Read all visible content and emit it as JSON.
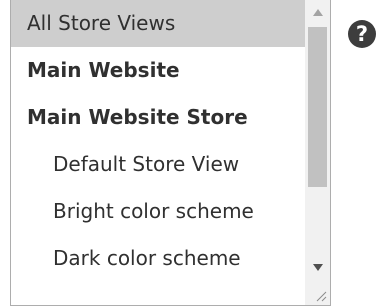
{
  "store_selector": {
    "options": [
      {
        "label": "All Store Views",
        "selected": true
      },
      {
        "label": "Main Website"
      },
      {
        "label": "Main Website Store"
      },
      {
        "label": "Default Store View"
      },
      {
        "label": "Bright color scheme"
      },
      {
        "label": "Dark color scheme"
      }
    ]
  },
  "help": {
    "glyph": "?"
  },
  "icons": {
    "scroll_up": "scroll-up-arrow",
    "scroll_down": "scroll-down-arrow",
    "help": "question-mark-circle",
    "resize": "resize-grip"
  }
}
